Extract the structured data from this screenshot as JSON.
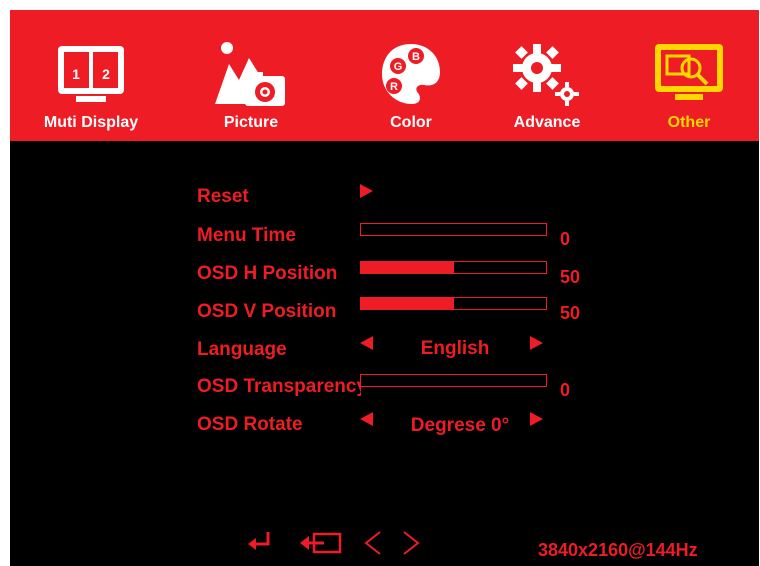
{
  "tabs": [
    {
      "label": "Muti Display",
      "icon": "multi-display-icon",
      "active": false,
      "icon_text_1": "1",
      "icon_text_2": "2"
    },
    {
      "label": "Picture",
      "icon": "picture-icon",
      "active": false
    },
    {
      "label": "Color",
      "icon": "color-palette-icon",
      "active": false,
      "icon_text_1": "G",
      "icon_text_2": "B",
      "icon_text_3": "R"
    },
    {
      "label": "Advance",
      "icon": "gears-icon",
      "active": false
    },
    {
      "label": "Other",
      "icon": "monitor-search-icon",
      "active": true
    }
  ],
  "settings": {
    "reset": {
      "label": "Reset"
    },
    "menu_time": {
      "label": "Menu Time",
      "value": "0",
      "level": 0
    },
    "osd_h_position": {
      "label": "OSD H Position",
      "value": "50",
      "level": 50
    },
    "osd_v_position": {
      "label": "OSD V Position",
      "value": "50",
      "level": 50
    },
    "language": {
      "label": "Language",
      "value": "English"
    },
    "osd_transparency": {
      "label": "OSD Transparency",
      "value": "0",
      "level": 0
    },
    "osd_rotate": {
      "label": "OSD Rotate",
      "value": "Degrese 0°"
    }
  },
  "status": {
    "resolution": "3840x2160@144Hz"
  },
  "nav_icons": [
    "enter-icon",
    "exit-icon",
    "chevron-left-icon",
    "chevron-right-icon"
  ],
  "colors": {
    "accent": "#ee1c24",
    "active_tab": "#ffd800",
    "background": "#000000",
    "icon": "#ffffff"
  }
}
